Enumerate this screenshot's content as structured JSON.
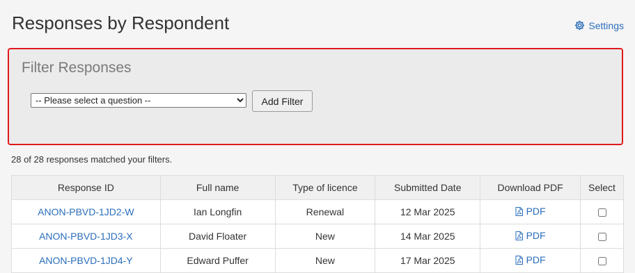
{
  "page": {
    "title": "Responses by Respondent"
  },
  "settings": {
    "label": "Settings",
    "icon": "gear-icon"
  },
  "filter": {
    "title": "Filter Responses",
    "select_value": "-- Please select a question --",
    "add_button": "Add Filter"
  },
  "summary": {
    "match_text": "28 of 28 responses matched your filters."
  },
  "table": {
    "headers": {
      "response_id": "Response ID",
      "full_name": "Full name",
      "licence_type": "Type of licence",
      "submitted": "Submitted Date",
      "download": "Download PDF",
      "select": "Select"
    },
    "rows": [
      {
        "id": "ANON-PBVD-1JD2-W",
        "name": "Ian Longfin",
        "licence": "Renewal",
        "date": "12 Mar 2025",
        "pdf": "PDF",
        "selected": false
      },
      {
        "id": "ANON-PBVD-1JD3-X",
        "name": "David Floater",
        "licence": "New",
        "date": "14 Mar 2025",
        "pdf": "PDF",
        "selected": false
      },
      {
        "id": "ANON-PBVD-1JD4-Y",
        "name": "Edward Puffer",
        "licence": "New",
        "date": "17 Mar 2025",
        "pdf": "PDF",
        "selected": false
      }
    ]
  },
  "colors": {
    "link": "#2a6ebb",
    "highlight_border": "#e0191c",
    "panel_bg": "#ebebeb"
  }
}
